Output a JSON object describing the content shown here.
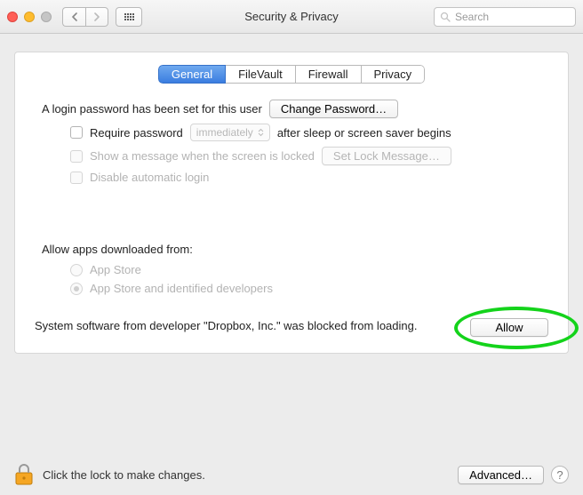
{
  "window": {
    "title": "Security & Privacy",
    "search_placeholder": "Search"
  },
  "tabs": [
    {
      "label": "General",
      "active": true
    },
    {
      "label": "FileVault",
      "active": false
    },
    {
      "label": "Firewall",
      "active": false
    },
    {
      "label": "Privacy",
      "active": false
    }
  ],
  "general": {
    "login_password_text": "A login password has been set for this user",
    "change_password_btn": "Change Password…",
    "require_password_label": "Require password",
    "require_password_delay": "immediately",
    "require_password_tail": "after sleep or screen saver begins",
    "show_message_label": "Show a message when the screen is locked",
    "set_lock_message_btn": "Set Lock Message…",
    "disable_auto_login_label": "Disable automatic login"
  },
  "downloads": {
    "heading": "Allow apps downloaded from:",
    "options": [
      {
        "label": "App Store",
        "selected": false
      },
      {
        "label": "App Store and identified developers",
        "selected": true
      }
    ]
  },
  "blocked": {
    "message": "System software from developer \"Dropbox, Inc.\" was blocked from loading.",
    "allow_btn": "Allow"
  },
  "footer": {
    "lock_text": "Click the lock to make changes.",
    "advanced_btn": "Advanced…"
  }
}
